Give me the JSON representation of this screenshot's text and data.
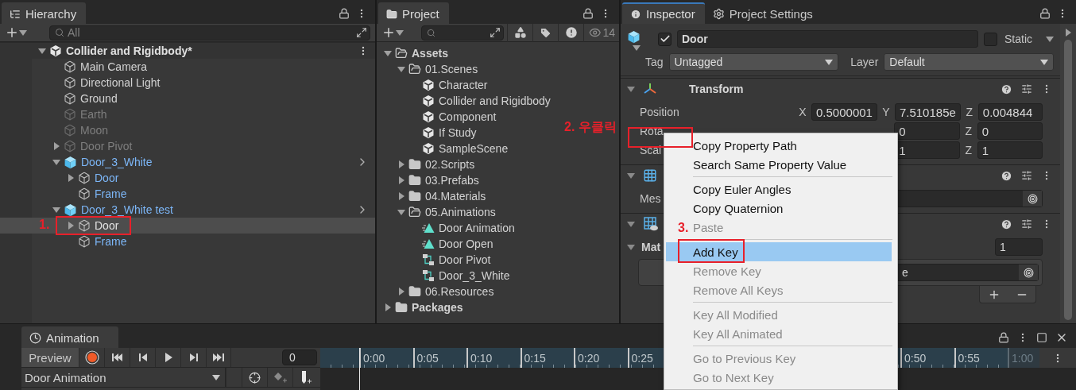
{
  "hierarchy": {
    "title": "Hierarchy",
    "search": {
      "placeholder": "All"
    },
    "scene": {
      "name": "Collider and Rigidbody*",
      "expanded": true,
      "children": [
        {
          "name": "Main Camera",
          "kind": "object",
          "inactive": false,
          "selected": false
        },
        {
          "name": "Directional Light",
          "kind": "object",
          "inactive": false,
          "selected": false
        },
        {
          "name": "Ground",
          "kind": "object",
          "inactive": false,
          "selected": false
        },
        {
          "name": "Earth",
          "kind": "object",
          "inactive": true,
          "selected": false
        },
        {
          "name": "Moon",
          "kind": "object",
          "inactive": true,
          "selected": false
        },
        {
          "name": "Door Pivot",
          "kind": "object",
          "inactive": true,
          "selected": false,
          "expanded": false
        },
        {
          "name": "Door_3_White",
          "kind": "prefab",
          "inactive": false,
          "selected": false,
          "expanded": true,
          "children": [
            {
              "name": "Door",
              "kind": "prefab-part",
              "inactive": false,
              "selected": false,
              "expanded": false
            },
            {
              "name": "Frame",
              "kind": "prefab-part",
              "inactive": false,
              "selected": false
            }
          ]
        },
        {
          "name": "Door_3_White test",
          "kind": "prefab",
          "inactive": false,
          "selected": false,
          "expanded": true,
          "children": [
            {
              "name": "Door",
              "kind": "prefab-part",
              "inactive": false,
              "selected": true,
              "expanded": false
            },
            {
              "name": "Frame",
              "kind": "prefab-part",
              "inactive": false,
              "selected": false
            }
          ]
        }
      ]
    }
  },
  "project": {
    "title": "Project",
    "count": "14",
    "tree": [
      {
        "name": "Assets",
        "kind": "folder",
        "expanded": true,
        "children": [
          {
            "name": "01.Scenes",
            "kind": "folder",
            "expanded": true,
            "children": [
              {
                "name": "Character",
                "kind": "scene"
              },
              {
                "name": "Collider and Rigidbody",
                "kind": "scene"
              },
              {
                "name": "Component",
                "kind": "scene"
              },
              {
                "name": "If Study",
                "kind": "scene"
              },
              {
                "name": "SampleScene",
                "kind": "scene"
              }
            ]
          },
          {
            "name": "02.Scripts",
            "kind": "folder",
            "expanded": false
          },
          {
            "name": "03.Prefabs",
            "kind": "folder",
            "expanded": false
          },
          {
            "name": "04.Materials",
            "kind": "folder",
            "expanded": false
          },
          {
            "name": "05.Animations",
            "kind": "folder",
            "expanded": true,
            "children": [
              {
                "name": "Door Animation",
                "kind": "clip"
              },
              {
                "name": "Door Open",
                "kind": "clip"
              },
              {
                "name": "Door Pivot",
                "kind": "controller"
              },
              {
                "name": "Door_3_White",
                "kind": "controller"
              }
            ]
          },
          {
            "name": "06.Resources",
            "kind": "folder",
            "expanded": false
          }
        ]
      },
      {
        "name": "Packages",
        "kind": "folder",
        "expanded": false
      }
    ]
  },
  "inspector": {
    "tabs": [
      {
        "label": "Inspector",
        "selected": true,
        "kind": "info"
      },
      {
        "label": "Project Settings",
        "selected": false,
        "kind": "gear"
      }
    ],
    "object": {
      "active": true,
      "name": "Door",
      "static": false,
      "static_label": "Static",
      "tag_label": "Tag",
      "tag": "Untagged",
      "layer_label": "Layer",
      "layer": "Default"
    },
    "transform": {
      "title": "Transform",
      "expanded": true,
      "rows": [
        {
          "label": "Position",
          "fields": [
            {
              "axis": "X",
              "value": "0.5000001"
            },
            {
              "axis": "Y",
              "value": "7.510185e"
            },
            {
              "axis": "Z",
              "value": "0.004844"
            }
          ]
        },
        {
          "label": "Rota",
          "fields": [
            {
              "value": "0"
            },
            {
              "axis": "Z",
              "value": "0"
            }
          ]
        },
        {
          "label": "Scal",
          "fields": [
            {
              "value": "1"
            },
            {
              "axis": "Z",
              "value": "1"
            }
          ]
        }
      ]
    },
    "components": [
      {
        "kind": "mesh-filter",
        "expanded": true,
        "row": {
          "label": "Mes"
        }
      },
      {
        "kind": "mesh-renderer",
        "expanded": true,
        "row": {
          "label": "Mat",
          "size": "1",
          "element": "e"
        }
      }
    ]
  },
  "context_menu": {
    "items": [
      {
        "kind": "item",
        "label": "Copy Property Path",
        "disabled": false,
        "selected": false
      },
      {
        "kind": "item",
        "label": "Search Same Property Value",
        "disabled": false,
        "selected": false
      },
      {
        "kind": "separator"
      },
      {
        "kind": "item",
        "label": "Copy Euler Angles",
        "disabled": false,
        "selected": false
      },
      {
        "kind": "item",
        "label": "Copy Quaternion",
        "disabled": false,
        "selected": false
      },
      {
        "kind": "item",
        "label": "Paste",
        "disabled": true,
        "selected": false
      },
      {
        "kind": "separator"
      },
      {
        "kind": "item",
        "label": "Add Key",
        "disabled": false,
        "selected": true
      },
      {
        "kind": "item",
        "label": "Remove Key",
        "disabled": true,
        "selected": false
      },
      {
        "kind": "item",
        "label": "Remove All Keys",
        "disabled": true,
        "selected": false
      },
      {
        "kind": "separator"
      },
      {
        "kind": "item",
        "label": "Key All Modified",
        "disabled": true,
        "selected": false
      },
      {
        "kind": "item",
        "label": "Key All Animated",
        "disabled": true,
        "selected": false
      },
      {
        "kind": "separator"
      },
      {
        "kind": "item",
        "label": "Go to Previous Key",
        "disabled": true,
        "selected": false
      },
      {
        "kind": "item",
        "label": "Go to Next Key",
        "disabled": true,
        "selected": false
      }
    ]
  },
  "annotations": [
    {
      "label": "1."
    },
    {
      "label": "2. 우클릭"
    },
    {
      "label": "3."
    }
  ],
  "animation": {
    "title": "Animation",
    "preview": "Preview",
    "frame": "0",
    "clip": "Door Animation",
    "ruler_left": [
      {
        "label": "0:00",
        "dim": false
      },
      {
        "label": "0:05",
        "dim": false
      },
      {
        "label": "0:10",
        "dim": false
      },
      {
        "label": "0:15",
        "dim": false
      },
      {
        "label": "0:20",
        "dim": false
      },
      {
        "label": "0:25",
        "dim": false
      }
    ],
    "ruler_right": [
      {
        "label": "0:50",
        "dim": false
      },
      {
        "label": "0:55",
        "dim": false
      },
      {
        "label": "1:00",
        "dim": true
      }
    ]
  }
}
